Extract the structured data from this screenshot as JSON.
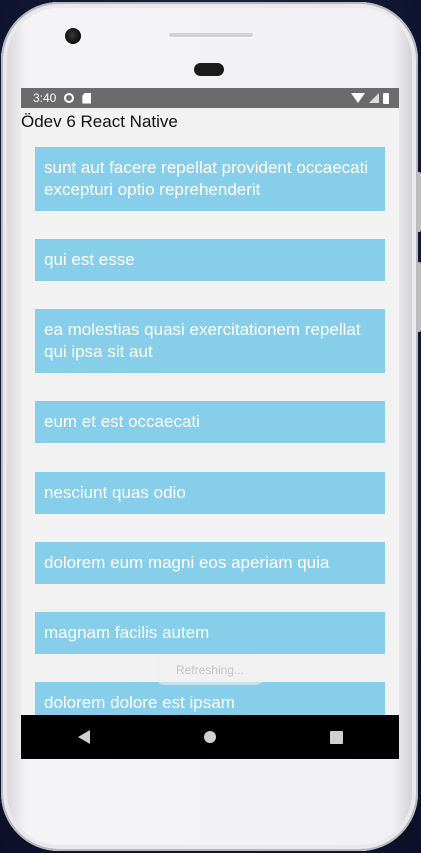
{
  "status_bar": {
    "time": "3:40",
    "icons": [
      "settings-icon",
      "sd-card-icon",
      "wifi-icon",
      "signal-icon",
      "battery-icon"
    ]
  },
  "app": {
    "title": "Ödev 6 React Native",
    "refreshing_label": "Refreshing...",
    "accent_color": "#87ceeb"
  },
  "posts": [
    "sunt aut facere repellat provident occaecati excepturi optio reprehenderit",
    "qui est esse",
    "ea molestias quasi exercitationem repellat qui ipsa sit aut",
    "eum et est occaecati",
    "nesciunt quas odio",
    "dolorem eum magni eos aperiam quia",
    "magnam facilis autem",
    "dolorem dolore est ipsam"
  ],
  "nav_bar": {
    "buttons": [
      "back-icon",
      "home-icon",
      "recents-icon"
    ]
  }
}
